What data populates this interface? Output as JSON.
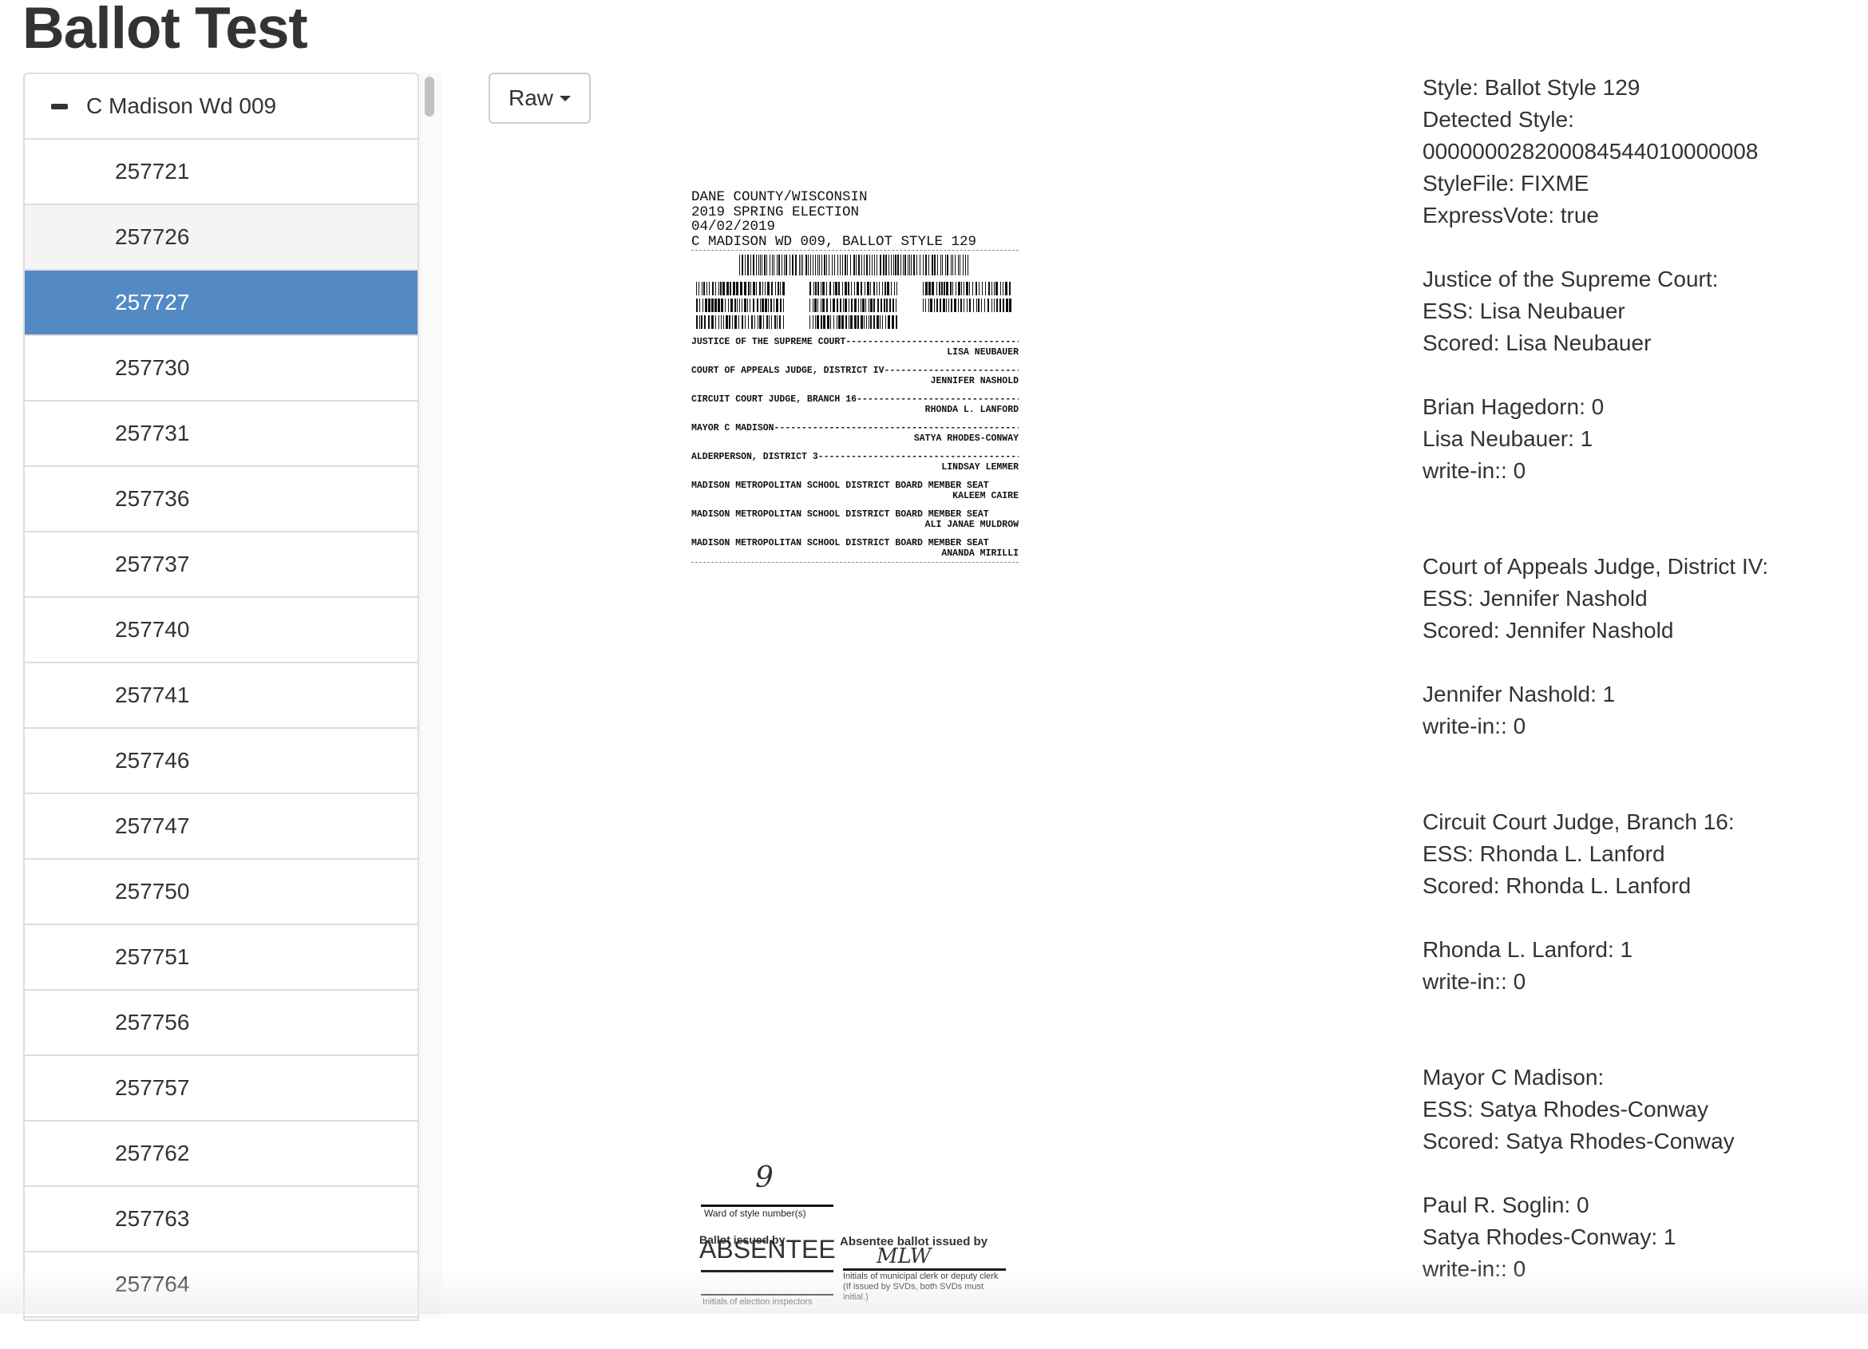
{
  "page_title": "Ballot Test",
  "sidebar": {
    "group_label": "C Madison Wd 009",
    "items": [
      "257721",
      "257726",
      "257727",
      "257730",
      "257731",
      "257736",
      "257737",
      "257740",
      "257741",
      "257746",
      "257747",
      "257750",
      "257751",
      "257756",
      "257757",
      "257762",
      "257763",
      "257764"
    ],
    "hover_item": "257726",
    "active_item": "257727",
    "active_color": "#548ac3"
  },
  "view_dropdown": {
    "label": "Raw"
  },
  "ballot_image": {
    "header": [
      "DANE COUNTY/WISCONSIN",
      "2019 SPRING ELECTION",
      "04/02/2019",
      "C MADISON WD 009, BALLOT STYLE 129"
    ],
    "contests": [
      {
        "office": "JUSTICE OF THE SUPREME COURT",
        "choice": "LISA NEUBAUER"
      },
      {
        "office": "COURT OF APPEALS JUDGE, DISTRICT IV",
        "choice": "JENNIFER NASHOLD"
      },
      {
        "office": "CIRCUIT COURT JUDGE, BRANCH 16",
        "choice": "RHONDA L. LANFORD"
      },
      {
        "office": "MAYOR C MADISON",
        "choice": "SATYA RHODES-CONWAY"
      },
      {
        "office": "ALDERPERSON, DISTRICT 3",
        "choice": "LINDSAY LEMMER"
      },
      {
        "office": "MADISON METROPOLITAN SCHOOL DISTRICT BOARD MEMBER SEAT",
        "choice": "KALEEM CAIRE"
      },
      {
        "office": "MADISON METROPOLITAN SCHOOL DISTRICT BOARD MEMBER SEAT",
        "choice": "ALI JANAE MULDROW"
      },
      {
        "office": "MADISON METROPOLITAN SCHOOL DISTRICT BOARD MEMBER SEAT",
        "choice": "ANANDA MIRILLI"
      }
    ],
    "footer": {
      "ward_value": "9",
      "ward_label": "Ward of style number(s)",
      "ballot_issued_by_label": "Ballot issued by",
      "ballot_issued_by_value": "ABSENTEE",
      "inspectors_label": "Initials of election inspectors",
      "absentee_label": "Absentee ballot issued by",
      "absentee_initials": "MLW",
      "clerk_label": "Initials of municipal clerk or deputy clerk (If issued by SVDs, both SVDs must initial.)"
    }
  },
  "details": {
    "info": [
      "Style: Ballot Style 129",
      "Detected Style:",
      "000000028200084544010000008",
      "StyleFile: FIXME",
      "ExpressVote: true"
    ],
    "contests": [
      {
        "title": "Justice of the Supreme Court:",
        "ess": "ESS: Lisa Neubauer",
        "scored": "Scored: Lisa Neubauer",
        "tallies": [
          "Brian Hagedorn: 0",
          "Lisa Neubauer: 1",
          "write-in:: 0"
        ]
      },
      {
        "title": "Court of Appeals Judge, District IV:",
        "ess": "ESS: Jennifer Nashold",
        "scored": "Scored: Jennifer Nashold",
        "tallies": [
          "Jennifer Nashold: 1",
          "write-in:: 0"
        ]
      },
      {
        "title": "Circuit Court Judge, Branch 16:",
        "ess": "ESS: Rhonda L. Lanford",
        "scored": "Scored: Rhonda L. Lanford",
        "tallies": [
          "Rhonda L. Lanford: 1",
          "write-in:: 0"
        ]
      },
      {
        "title": "Mayor C Madison:",
        "ess": "ESS: Satya Rhodes-Conway",
        "scored": "Scored: Satya Rhodes-Conway",
        "tallies": [
          "Paul R. Soglin: 0",
          "Satya Rhodes-Conway: 1",
          "write-in:: 0"
        ]
      }
    ]
  }
}
